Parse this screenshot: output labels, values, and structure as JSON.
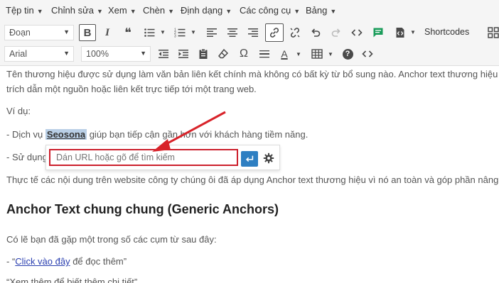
{
  "menubar": {
    "items": [
      {
        "label": "Tệp tin"
      },
      {
        "label": "Chỉnh sửa"
      },
      {
        "label": "Xem"
      },
      {
        "label": "Chèn"
      },
      {
        "label": "Định dạng"
      },
      {
        "label": "Các công cụ"
      },
      {
        "label": "Bảng"
      }
    ]
  },
  "toolbar1": {
    "block_format": "Đoạn",
    "bold": "B",
    "italic": "I",
    "quote": "❝",
    "shortcodes_label": "Shortcodes"
  },
  "toolbar2": {
    "font_family": "Arial",
    "font_size": "100%",
    "omega": "Ω",
    "text_color": "A",
    "help": "?",
    "code": "<>"
  },
  "content": {
    "p1_line1": "Tên thương hiệu được sử dụng làm văn bản liên kết chính mà không có bất kỳ từ bổ sung nào. Anchor text thương hiệu",
    "p1_line2": "trích dẫn một nguồn hoặc liên kết trực tiếp tới một trang web.",
    "example_label": "Ví dụ:",
    "line_a_prefix": "- Dịch vụ ",
    "line_a_highlight": "Seosona",
    "line_a_suffix": " giúp bạn tiếp cận gần hơn với khách hàng tiềm năng.",
    "line_b_prefix": "- Sử dụng",
    "p_after": "Thực tế các nội dung trên website công ty chúng ôi đã áp dụng Anchor text thương hiệu vì nó an toàn và góp phần nâng",
    "heading": "Anchor Text chung chung (Generic Anchors)",
    "p_intro": "Có lẽ bạn đã gặp một trong số các cụm từ sau đây:",
    "item1_prefix": "- “",
    "item1_link": "Click vào đây",
    "item1_suffix": " để đọc thêm”",
    "item2_partial": "“Xem thêm để biết thêm chi tiết”"
  },
  "link_popup": {
    "placeholder": "Dán URL hoặc gõ để tìm kiếm"
  },
  "colors": {
    "accent": "#2e7fc2",
    "highlight_border": "#cc1f2c",
    "arrow": "#d8232a",
    "selection": "#b9cfe6",
    "link": "#2a3fb0"
  }
}
